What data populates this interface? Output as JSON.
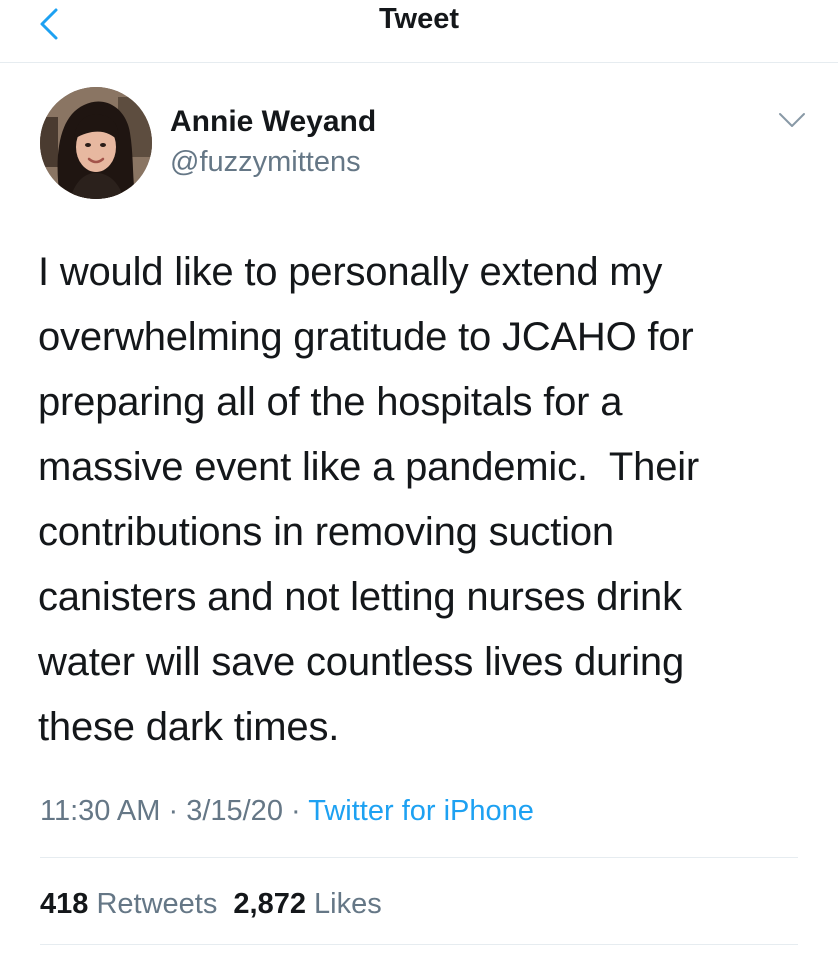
{
  "header": {
    "title": "Tweet",
    "back_icon": "chevron-left-icon"
  },
  "author": {
    "name": "Annie Weyand",
    "handle": "@fuzzymittens"
  },
  "menu_icon": "chevron-down-icon",
  "tweet": {
    "lines": [
      "I would like to personally extend my",
      "overwhelming gratitude to JCAHO for",
      "preparing all of the hospitals for a",
      "massive event like a pandemic.  Their",
      "contributions in removing suction",
      "canisters and not letting nurses drink",
      "water will save countless lives during",
      "these dark times."
    ]
  },
  "meta": {
    "time": "11:30 AM",
    "separator": "·",
    "date": "3/15/20",
    "source": "Twitter for iPhone"
  },
  "stats": {
    "retweets_count": "418",
    "retweets_label": "Retweets",
    "likes_count": "2,872",
    "likes_label": "Likes"
  },
  "colors": {
    "accent": "#1da1f2",
    "text": "#14171a",
    "secondary": "#657786",
    "divider": "#e6ecf0"
  }
}
